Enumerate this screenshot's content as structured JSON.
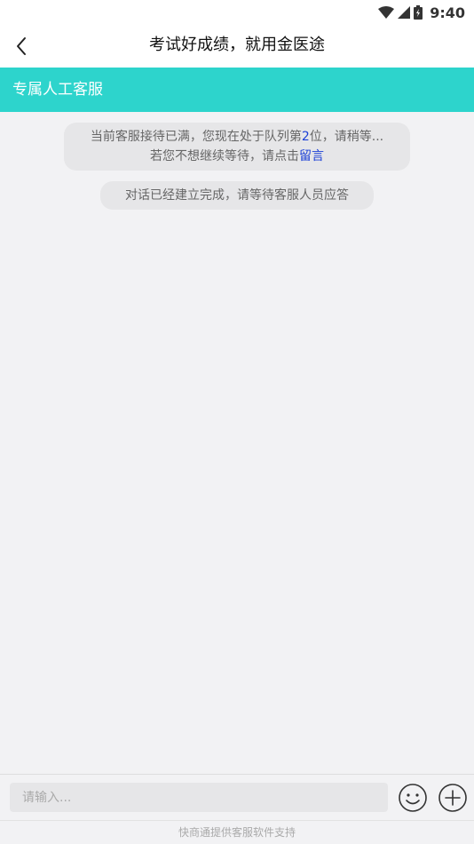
{
  "status_bar": {
    "time": "9:40",
    "icons": [
      "wifi-icon",
      "signal-icon",
      "battery-icon"
    ]
  },
  "header": {
    "title": "考试好成绩，就用金医途",
    "back_icon": "chevron-left-icon"
  },
  "subheader": {
    "label": "专属人工客服",
    "color": "#2dd4cc"
  },
  "chat": {
    "queue_notice": {
      "part1": "当前客服接待已满，您现在处于队列第",
      "position": "2",
      "part2": "位，请稍等...",
      "line2_prefix": "若您不想继续等待，请点击",
      "link_text": "留言"
    },
    "connected_notice": "对话已经建立完成，请等待客服人员应答"
  },
  "input_bar": {
    "placeholder": "请输入...",
    "emoji_icon": "smiley-icon",
    "plus_icon": "plus-circle-icon"
  },
  "footer": {
    "text": "快商通提供客服软件支持"
  }
}
